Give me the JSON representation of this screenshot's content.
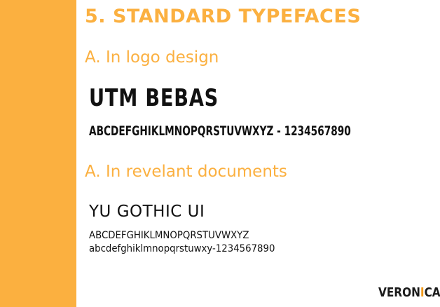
{
  "slide": {
    "title": "5. STANDARD TYPEFACES",
    "sections": [
      {
        "heading": "A. In logo design",
        "font_name": "UTM BEBAS",
        "samples": [
          "ABCDEFGHIKLMNOPQRSTUVWXYZ - 1234567890"
        ]
      },
      {
        "heading": "A. In revelant documents",
        "font_name": "YU GOTHIC UI",
        "samples": [
          "ABCDEFGHIKLMNOPQRSTUVWXYZ",
          "abcdefghiklmnopqrstuwxy-1234567890"
        ]
      }
    ],
    "logo": {
      "prefix": "VERON",
      "accent": "I",
      "suffix": "CA"
    }
  },
  "colors": {
    "accent": "#fbb040",
    "text": "#111111",
    "background": "#ffffff"
  }
}
